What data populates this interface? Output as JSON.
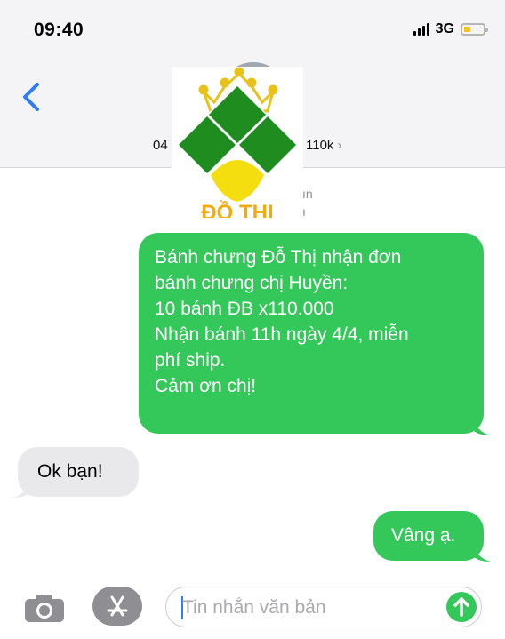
{
  "status_bar": {
    "time": "09:40",
    "network": "3G",
    "signal-icon": "cellular-signal",
    "battery-icon": "battery-low",
    "battery_level": 0.25,
    "battery_color": "#f4c21e"
  },
  "header": {
    "back_icon": "chevron-left",
    "contact_name_left": "04",
    "contact_name_right": "110k",
    "contact_chevron": "›",
    "logo_text": "ĐỒ THỊ",
    "sub_info_line1": "ın",
    "sub_info_line2": "ı"
  },
  "messages": [
    {
      "direction": "sent",
      "lines": [
        "Bánh chưng Đỗ Thị nhận đơn",
        "bánh chưng chị Huyền:",
        "10 bánh ĐB x110.000",
        "Nhận bánh 11h ngày 4/4, miễn",
        "phí ship.",
        "Cảm ơn chị!"
      ]
    },
    {
      "direction": "received",
      "text": "Ok bạn!"
    },
    {
      "direction": "sent",
      "text": "Vâng ạ."
    }
  ],
  "composer": {
    "camera_icon": "camera",
    "appstore_icon": "app-store",
    "placeholder": "Tin nhắn văn bản",
    "send_icon": "arrow-up"
  },
  "colors": {
    "sent_bubble": "#34c759",
    "received_bubble": "#e9e9eb",
    "accent": "#2f7cf6"
  }
}
